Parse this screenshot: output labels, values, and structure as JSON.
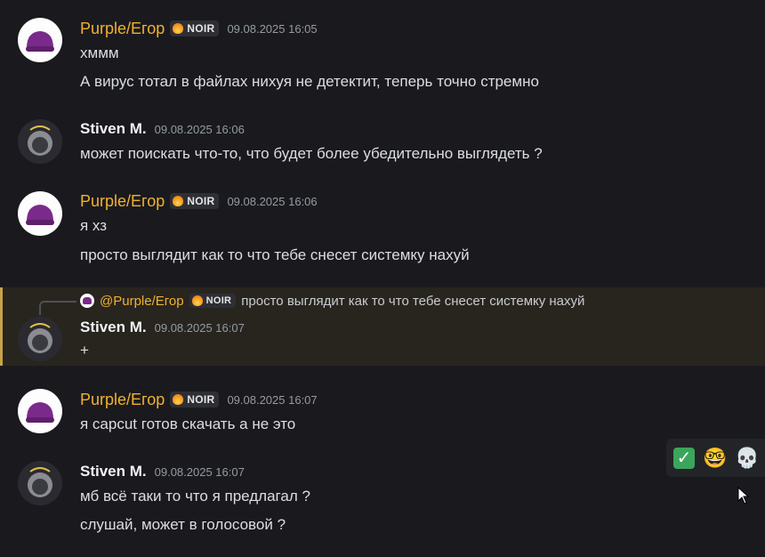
{
  "messages": [
    {
      "author": "Purple/Егор",
      "tag": "NOIR",
      "time": "09.08.2025 16:05",
      "lines": [
        "хммм",
        "А вирус тотал в файлах нихуя не детектит, теперь точно стремно"
      ]
    },
    {
      "author": "Stiven M.",
      "time": "09.08.2025 16:06",
      "lines": [
        "может поискать что-то, что будет более убедительно выглядеть ?"
      ]
    },
    {
      "author": "Purple/Егор",
      "tag": "NOIR",
      "time": "09.08.2025 16:06",
      "lines": [
        "я хз",
        "просто выглядит как то что тебе снесет системку нахуй"
      ]
    },
    {
      "author": "Stiven M.",
      "time": "09.08.2025 16:07",
      "reply": {
        "author": "@Purple/Егор",
        "tag": "NOIR",
        "text": "просто выглядит как то что тебе снесет системку нахуй"
      },
      "lines": [
        "+"
      ]
    },
    {
      "author": "Purple/Егор",
      "tag": "NOIR",
      "time": "09.08.2025 16:07",
      "lines": [
        "я capcut готов скачать а не это"
      ]
    },
    {
      "author": "Stiven M.",
      "time": "09.08.2025 16:07",
      "lines": [
        "мб всё таки то что я предлагал ?",
        "слушай, может в голосовой ?"
      ]
    }
  ],
  "reactions": {
    "items": [
      "✅",
      "🤓",
      "💀"
    ],
    "icons": [
      "check-icon",
      "nerd-face-icon",
      "skull-icon"
    ]
  },
  "colors": {
    "background": "#1a1a1e",
    "purple_name": "#f0b132",
    "reply_highlight": "#28251f",
    "reply_bar": "#c9a24a"
  }
}
